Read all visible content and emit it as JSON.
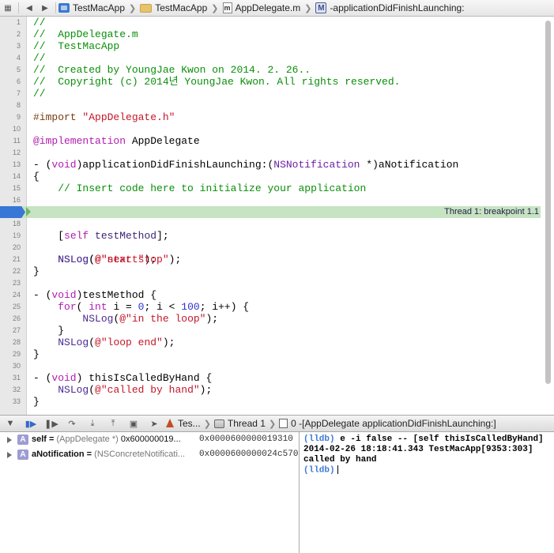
{
  "jumpbar": {
    "crumbs": [
      "TestMacApp",
      "TestMacApp",
      "AppDelegate.m",
      "-applicationDidFinishLaunching:"
    ],
    "icon_m": "m",
    "icon_M": "M"
  },
  "editor": {
    "breakpoint_line": "17",
    "thread_label": "Thread 1: breakpoint 1.1"
  },
  "debug": {
    "target": "Tes...",
    "thread": "Thread 1",
    "frame": "0 -[AppDelegate applicationDidFinishLaunching:]"
  },
  "variables": [
    {
      "badge": "A",
      "name": "self",
      "type": "(AppDelegate *)",
      "value": "0x600000019...",
      "address": "0x0000600000019310"
    },
    {
      "badge": "A",
      "name": "aNotification",
      "type": "(NSConcreteNotificati...",
      "value": "",
      "address": "0x0000600000024c570"
    }
  ],
  "console": {
    "prompt": "(lldb)",
    "command": "e -i false -- [self thisIsCalledByHand]",
    "output1": "2014-02-26 18:18:41.343 TestMacApp[9353:303]",
    "output2": "called by hand"
  },
  "colors": {
    "comment": "#0a8f0a",
    "keyword": "#b11bb0",
    "string": "#c4162a",
    "breakpoint": "#3877d5",
    "current_line": "#c6e3c2"
  }
}
